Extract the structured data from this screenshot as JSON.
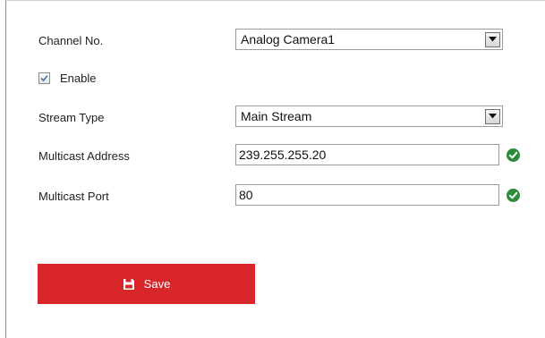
{
  "form": {
    "channel": {
      "label": "Channel No.",
      "value": "Analog Camera1"
    },
    "enable": {
      "label": "Enable",
      "checked": true
    },
    "stream_type": {
      "label": "Stream Type",
      "value": "Main Stream"
    },
    "multicast_address": {
      "label": "Multicast Address",
      "value": "239.255.255.20",
      "status_icon": "check-circle-icon"
    },
    "multicast_port": {
      "label": "Multicast Port",
      "value": "80",
      "status_icon": "check-circle-icon"
    }
  },
  "actions": {
    "save_label": "Save",
    "save_icon": "floppy-disk-icon"
  },
  "colors": {
    "accent": "#d9262b",
    "valid": "#2e8b3c"
  }
}
